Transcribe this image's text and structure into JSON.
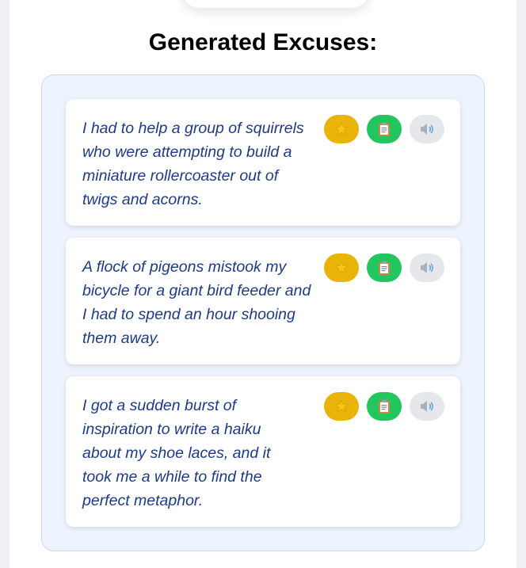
{
  "heading": "Generated Excuses:",
  "excuses": [
    {
      "text": "I had to help a group of squirrels who were attempting to build a miniature rollercoaster out of twigs and acorns."
    },
    {
      "text": "A flock of pigeons mistook my bicycle for a giant bird feeder and I had to spend an hour shooing them away."
    },
    {
      "text": "I got a sudden burst of inspiration to write a haiku about my shoe laces, and it took me a while to find the perfect metaphor."
    }
  ],
  "actions": {
    "favorite_icon": "star-icon",
    "copy_icon": "clipboard-icon",
    "speak_icon": "speaker-icon"
  },
  "colors": {
    "favorite_button": "#eab308",
    "copy_button": "#22c55e",
    "speak_button": "#e5e7eb",
    "excuse_text": "#1e3a8a",
    "results_background": "#eef4ff"
  }
}
